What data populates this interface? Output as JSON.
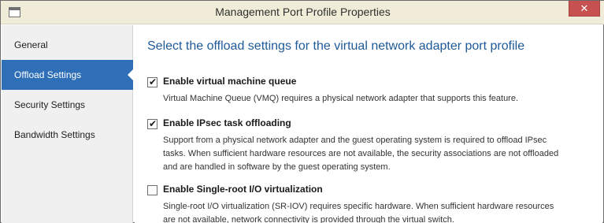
{
  "window": {
    "title": "Management Port Profile Properties",
    "close_glyph": "✕"
  },
  "sidebar": {
    "items": [
      {
        "label": "General",
        "selected": false
      },
      {
        "label": "Offload Settings",
        "selected": true
      },
      {
        "label": "Security Settings",
        "selected": false
      },
      {
        "label": "Bandwidth Settings",
        "selected": false
      }
    ]
  },
  "content": {
    "heading": "Select the offload settings for the virtual network adapter port profile",
    "options": [
      {
        "label": "Enable virtual machine queue",
        "checked": true,
        "description": "Virtual Machine Queue (VMQ) requires a physical network adapter that supports this feature."
      },
      {
        "label": "Enable IPsec task offloading",
        "checked": true,
        "description": "Support from a physical network adapter and the guest operating system is required to offload IPsec tasks. When sufficient hardware resources are not available, the security associations are not offloaded and are handled in software by the guest operating system."
      },
      {
        "label": "Enable Single-root I/O virtualization",
        "checked": false,
        "description": "Single-root I/O virtualization (SR-IOV) requires specific hardware. When sufficient hardware resources are not available, network connectivity is provided through the virtual switch."
      }
    ]
  },
  "icons": {
    "app": "window-icon",
    "check": "✔"
  },
  "colors": {
    "accent": "#2e6fb7",
    "heading": "#1e5a99",
    "close": "#c75050",
    "titlebar": "#f0ecd8"
  }
}
